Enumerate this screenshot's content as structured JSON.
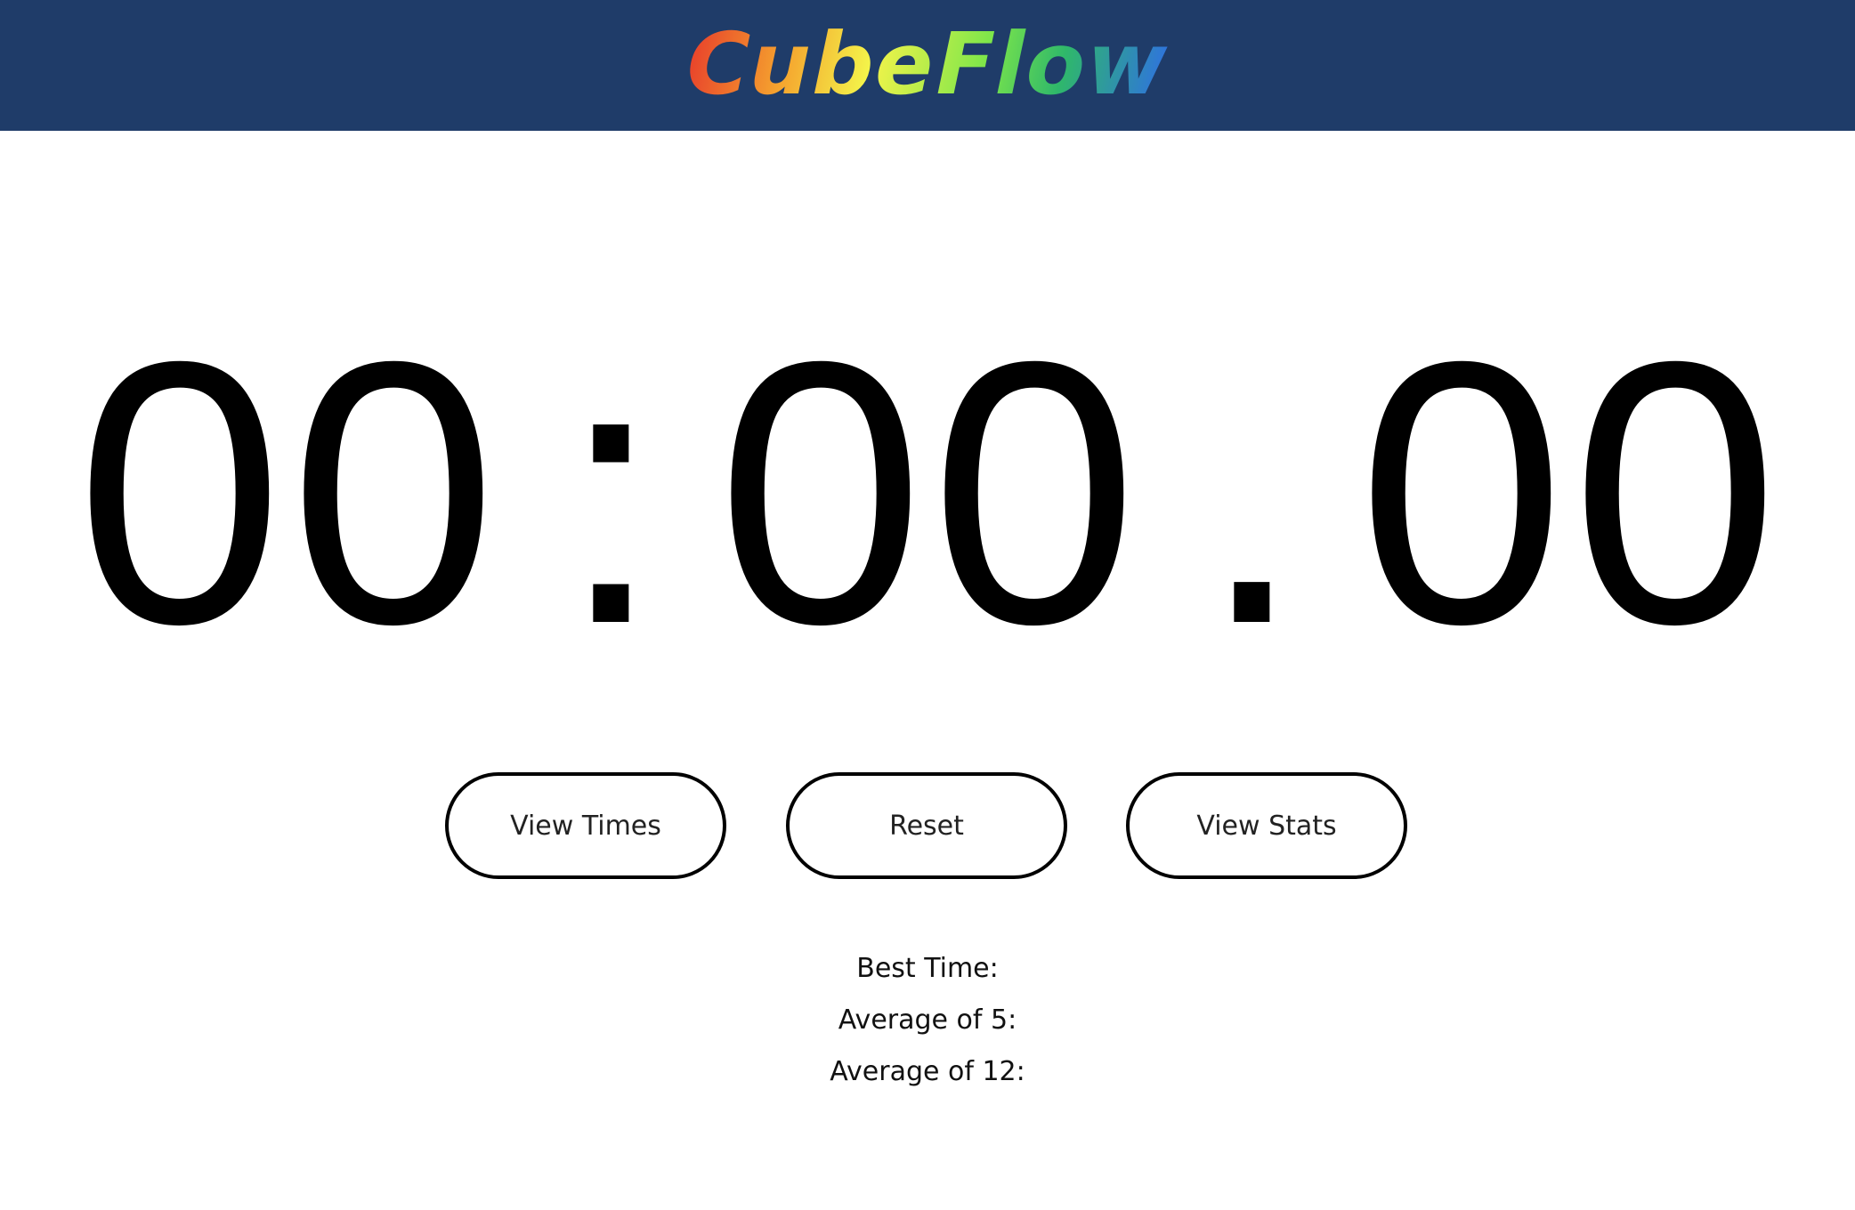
{
  "header": {
    "logo_text": "CubeFlow",
    "background_color": "#1f3c69"
  },
  "timer": {
    "d1": "0",
    "d2": "0",
    "colon": ":",
    "d3": "0",
    "d4": "0",
    "dot": ".",
    "d5": "0",
    "d6": "0"
  },
  "buttons": {
    "view_times": "View Times",
    "reset": "Reset",
    "view_stats": "View Stats"
  },
  "stats": {
    "best_time": "Best Time:",
    "average_of_5": "Average of 5:",
    "average_of_12": "Average of 12:"
  }
}
